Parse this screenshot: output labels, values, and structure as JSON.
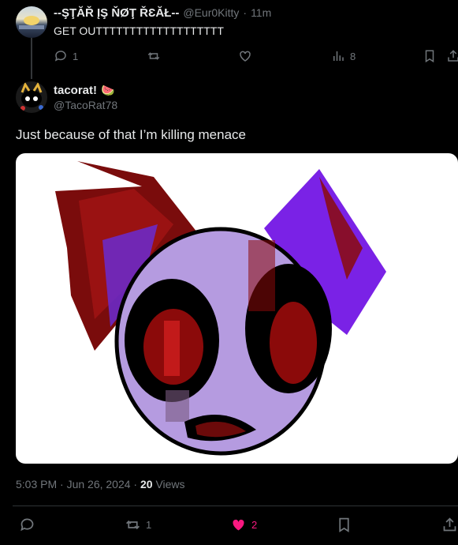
{
  "parent_tweet": {
    "display_name": "--ŞŢĂŘ ĮŞ ŇØŢ ŘƐĂŁ--",
    "handle": "@Eur0Kitty",
    "separator": "·",
    "time": "11m",
    "text": "GET OUTTTTTTTTTTTTTTTTTTT",
    "replies": "1",
    "views": "8"
  },
  "main_tweet": {
    "display_name": "tacorat!",
    "name_emoji": "🍉",
    "handle": "@TacoRat78",
    "text": "Just because of that I’m killing menace",
    "timestamp": "5:03 PM · Jun 26, 2024 · ",
    "views_count": "20",
    "views_label": " Views",
    "retweets": "1",
    "likes": "2"
  },
  "colors": {
    "background": "#000000",
    "text": "#e7e9ea",
    "muted": "#71767b",
    "like": "#f91880",
    "media_purple": "#b59be0",
    "media_violet": "#7a22e6",
    "media_red": "#8b0a0a"
  },
  "icons": [
    "reply-icon",
    "retweet-icon",
    "like-icon",
    "views-icon",
    "bookmark-icon",
    "share-icon"
  ]
}
